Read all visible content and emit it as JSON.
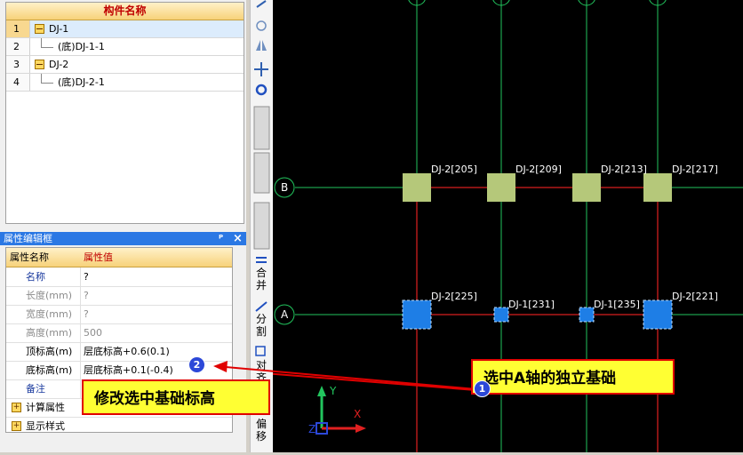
{
  "tree": {
    "header": "构件名称",
    "rows": [
      {
        "num": "1",
        "name": "DJ-1"
      },
      {
        "num": "2",
        "name": "(底)DJ-1-1"
      },
      {
        "num": "3",
        "name": "DJ-2"
      },
      {
        "num": "4",
        "name": "(底)DJ-2-1"
      }
    ]
  },
  "props": {
    "title": "属性编辑框",
    "pin": "ᴾ",
    "close": "×",
    "col_name": "属性名称",
    "col_value": "属性值",
    "rows": [
      {
        "name": "名称",
        "value": "?"
      },
      {
        "name": "长度(mm)",
        "value": "?"
      },
      {
        "name": "宽度(mm)",
        "value": "?"
      },
      {
        "name": "高度(mm)",
        "value": "500"
      },
      {
        "name": "顶标高(m)",
        "value": "层底标高+0.6(0.1)"
      },
      {
        "name": "底标高(m)",
        "value": "层底标高+0.1(-0.4)"
      },
      {
        "name": "备注",
        "value": ""
      },
      {
        "name": "计算属性",
        "value": ""
      },
      {
        "name": "显示样式",
        "value": ""
      }
    ],
    "expand_sign": "+"
  },
  "toolbar": {
    "merge": "合并",
    "split": "分割",
    "extra": "对齐",
    "last": "偏移"
  },
  "canvas": {
    "axis_b": "B",
    "axis_a": "A",
    "labels_b": [
      "DJ-2[205]",
      "DJ-2[209]",
      "DJ-2[213]",
      "DJ-2[217]"
    ],
    "labels_a": [
      "DJ-2[225]",
      "DJ-1[231]",
      "DJ-1[235]",
      "DJ-2[221]"
    ],
    "ucs_y": "Y",
    "ucs_x": "X",
    "ucs_z": "Z"
  },
  "callouts": {
    "c1": "选中A轴的独立基础",
    "c2": "修改选中基础标高",
    "b1": "1",
    "b2": "2"
  },
  "colors": {
    "selected": "#1e7ee6",
    "unselected": "#b5c87a",
    "grid": "#22c55e",
    "beam": "#e02020"
  }
}
